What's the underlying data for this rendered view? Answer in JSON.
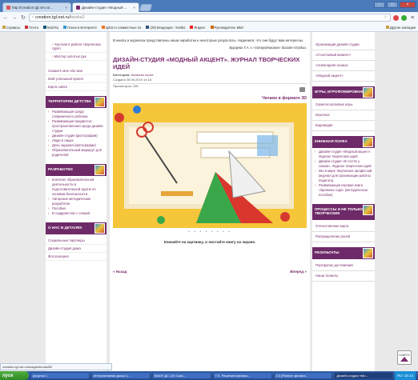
{
  "browser": {
    "tabs": [
      {
        "label": "http://creation.tgl.net.ru/..."
      },
      {
        "label": "Дизайн-студия «Модный ..."
      }
    ],
    "url_prefix": "creation.tgl.net.ru/",
    "url_path": "books2",
    "bookmarks": [
      "Сервисы",
      "Почта",
      "Mail.Ru",
      "Поиск в Интернете",
      "spb3.ru совместные по",
      "(29) Входящие - ksstbs",
      "Яндекс",
      "Руководитель МБУ"
    ],
    "bookmarks_right": "Другие закладки",
    "status_url": "creation.tgl.net.ru/images/books/52"
  },
  "left": {
    "links_top": [
      "Частная в работе творческих групп",
      "Мастер золотых рук"
    ],
    "links_main": [
      "Скажите мне обо мне",
      "Мой успешный проект",
      "Карта сайта"
    ],
    "block1": {
      "title": "Территории детства",
      "items": [
        "Развивающая среда современного ребенка",
        "Развивающая предметно-пространственная среда дизайн-студии",
        "Дизайн-студия (фотографии)",
        "Люди в лицах",
        "День задания (фотографии)",
        "Образовательный маршрут для родителей"
      ]
    },
    "block2": {
      "title": "Разработки",
      "items": [
        "Конспект образовательной деятельности в подготовительной группе по основам безопасности",
        "Авторские методические разработки",
        "Пособия",
        "В содружестве с семьей"
      ]
    },
    "block3": {
      "title": "О нас в деталях",
      "items": [
        "Социальные партнеры",
        "Дизайн-студия дома",
        "Фотогалерея"
      ]
    }
  },
  "main": {
    "intro": "В книгах и журналах представлены наши наработки и некоторые результаты. Надеемся, что они будут вам интересны.",
    "signature": "Бурцева Т.А. с «сотрудниками» дизайн-студии.",
    "title": "Дизайн-студия «Модный акцент». Журнал творческих идей",
    "category_label": "Категория:",
    "category": "Книжная полка",
    "created": "Создано 28.05.2019 14:18",
    "views": "Просмотров: 239",
    "read3d": "Читаем в формате 3D",
    "pager": "• • • • • • • •",
    "hint": "Кликайте на картинку, и листайте книгу на экране.",
    "prev": "« Назад",
    "next": "Вперед »"
  },
  "right": {
    "links_top": [
      "Организация дизайн-студии",
      "«Счастливый момент»",
      "«Новогодняя сказка»",
      "«Модный акцент»"
    ],
    "block1": {
      "title": "Игры, игрофомирование",
      "items": [
        "Сюжетно-ролевые игры",
        "Игротека",
        "Кидландия"
      ]
    },
    "block2": {
      "title": "Книжная полка",
      "items": [
        "Дизайн-студия «Модный акцент». Журнал творческих идей",
        "Дизайн-студия «В гостях у сказки». Журнал творческих идей",
        "Мы в мире творческих профессий (журнал для организации работы педагога)",
        "Развивающая игровая книга «Времена года» (методическое пособие)"
      ]
    },
    "block3": {
      "title": "Процессы и не только творческие",
      "items": [
        "Отечественная карта",
        "Распределение ролей"
      ]
    },
    "block4": {
      "title": "Результаты",
      "items": [
        "Портфолио достижений",
        "Наши таланты"
      ]
    }
  },
  "scrollup": "НАВЕРХ",
  "taskbar": {
    "start": "пуск",
    "tasks": [
      "рисунок 1",
      "интерактивная доска 1...",
      "МАОУ ДС 120 Сказ...",
      "Т.Е. Решение/организ...",
      "3.3 (Разное организ...",
      "Дизайн-студия «Мо..."
    ],
    "lang": "RU",
    "time": "15:14"
  }
}
